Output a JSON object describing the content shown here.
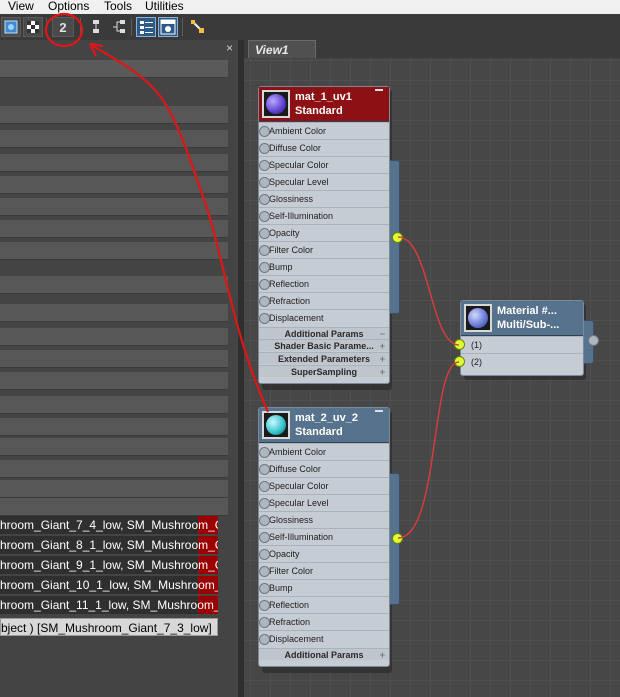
{
  "menu": [
    "View",
    "Options",
    "Tools",
    "Utilities"
  ],
  "toolbar": {
    "buttons": [
      {
        "icon": "grid-icon"
      },
      {
        "icon": "checker-icon"
      },
      {
        "icon": "two-views-icon",
        "label": "2"
      },
      {
        "icon": "layout-down-icon"
      },
      {
        "icon": "layout-tree-icon"
      },
      {
        "icon": "list-view-icon"
      },
      {
        "icon": "sample-slots-icon"
      },
      {
        "icon": "pick-material-icon"
      }
    ]
  },
  "left_panel": {
    "close_label": "×",
    "rows": [
      "hroom_Giant_7_4_low, SM_Mushroom_G...",
      "hroom_Giant_8_1_low, SM_Mushroom_G...",
      "hroom_Giant_9_1_low, SM_Mushroom_G...",
      "hroom_Giant_10_1_low, SM_Mushroom_...",
      "hroom_Giant_11_1_low, SM_Mushroom_..."
    ],
    "status": "bject ) [SM_Mushroom_Giant_7_3_low]"
  },
  "view": {
    "tab_label": "View1"
  },
  "nodes": {
    "mat1": {
      "title": "mat_1_uv1",
      "subtitle": "Standard",
      "slots": [
        "Ambient Color",
        "Diffuse Color",
        "Specular Color",
        "Specular Level",
        "Glossiness",
        "Self-Illumination",
        "Opacity",
        "Filter Color",
        "Bump",
        "Reflection",
        "Refraction",
        "Displacement"
      ],
      "rollouts": [
        {
          "label": "Additional Params",
          "sign": "−"
        },
        {
          "label": "Shader Basic Parame...",
          "sign": "+"
        },
        {
          "label": "Extended Parameters",
          "sign": "+"
        },
        {
          "label": "SuperSampling",
          "sign": "+"
        }
      ]
    },
    "mat2": {
      "title": "mat_2_uv_2",
      "subtitle": "Standard",
      "slots": [
        "Ambient Color",
        "Diffuse Color",
        "Specular Color",
        "Specular Level",
        "Glossiness",
        "Self-Illumination",
        "Opacity",
        "Filter Color",
        "Bump",
        "Reflection",
        "Refraction",
        "Displacement"
      ],
      "rollouts": [
        {
          "label": "Additional Params",
          "sign": "+"
        }
      ]
    },
    "multi": {
      "title": "Material #...",
      "subtitle": "Multi/Sub-...",
      "slots": [
        "(1)",
        "(2)"
      ]
    }
  },
  "colors": {
    "selected_header": "#8d1014",
    "node_header": "#56728c",
    "wire": "#d43c3c",
    "socket_active": "#dcff36",
    "annotation": "#e01616"
  }
}
